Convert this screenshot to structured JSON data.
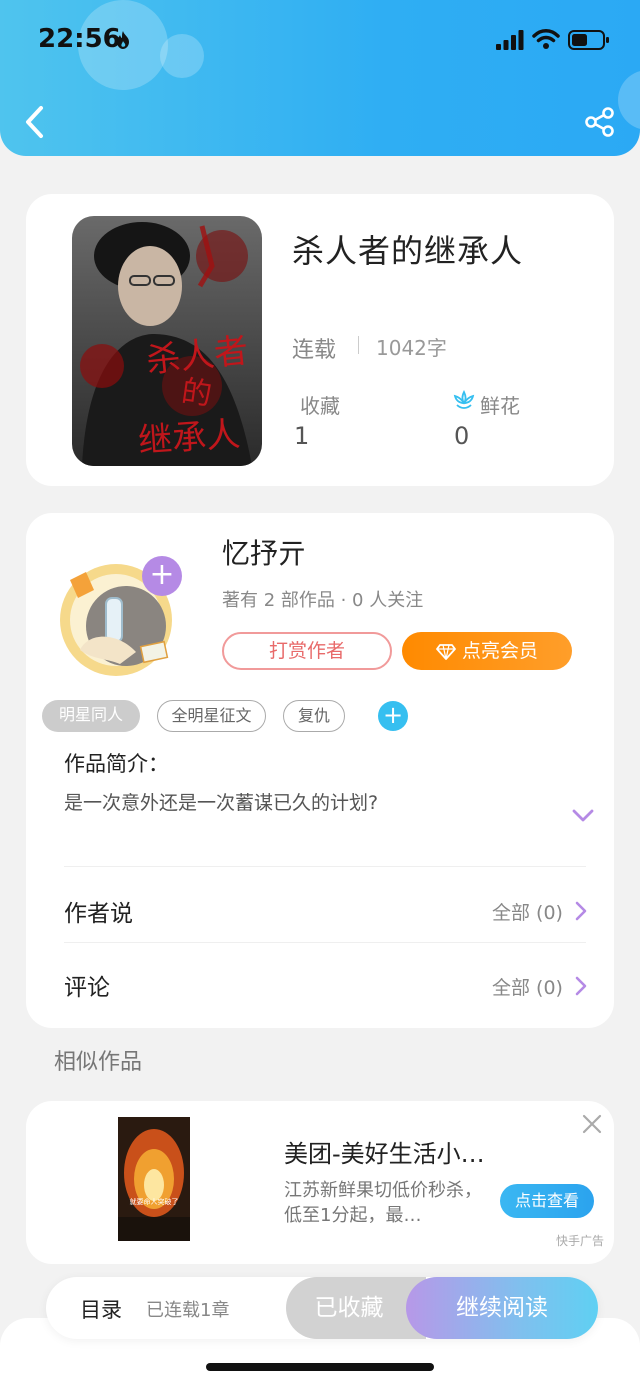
{
  "status_bar": {
    "time": "22:56"
  },
  "colors": {
    "header_blue": "#2faef3",
    "vip_orange": "#ff8a00",
    "accent_purple": "#b58ae5",
    "reward_red": "#e86a6a"
  },
  "book": {
    "title": "杀人者的继承人",
    "status": "连载",
    "word_count": "1042字",
    "favorites_label": "收藏",
    "favorites_value": "1",
    "flowers_label": "鲜花",
    "flowers_value": "0",
    "cover_text": [
      "杀人者",
      "的",
      "继承人"
    ]
  },
  "author": {
    "name": "忆抒亓",
    "meta": "著有 2 部作品 · 0 人关注",
    "reward_label": "打赏作者",
    "vip_label": "点亮会员"
  },
  "tags": [
    "明星同人",
    "全明星征文",
    "复仇"
  ],
  "intro": {
    "title": "作品简介：",
    "text": "是一次意外还是一次蓄谋已久的计划?"
  },
  "rows": [
    {
      "label": "作者说",
      "all": "全部 (0)"
    },
    {
      "label": "评论",
      "all": "全部 (0)"
    }
  ],
  "similar": {
    "title": "相似作品"
  },
  "ad": {
    "title": "美团-美好生活小…",
    "desc": "江苏新鲜果切低价秒杀，低至1分起，最…",
    "button": "点击查看",
    "source": "快手广告",
    "image_caption": "就要命人突破了"
  },
  "bottom": {
    "toc_label": "目录",
    "toc_count": "已连载1章",
    "collected_label": "已收藏",
    "read_label": "继续阅读"
  }
}
